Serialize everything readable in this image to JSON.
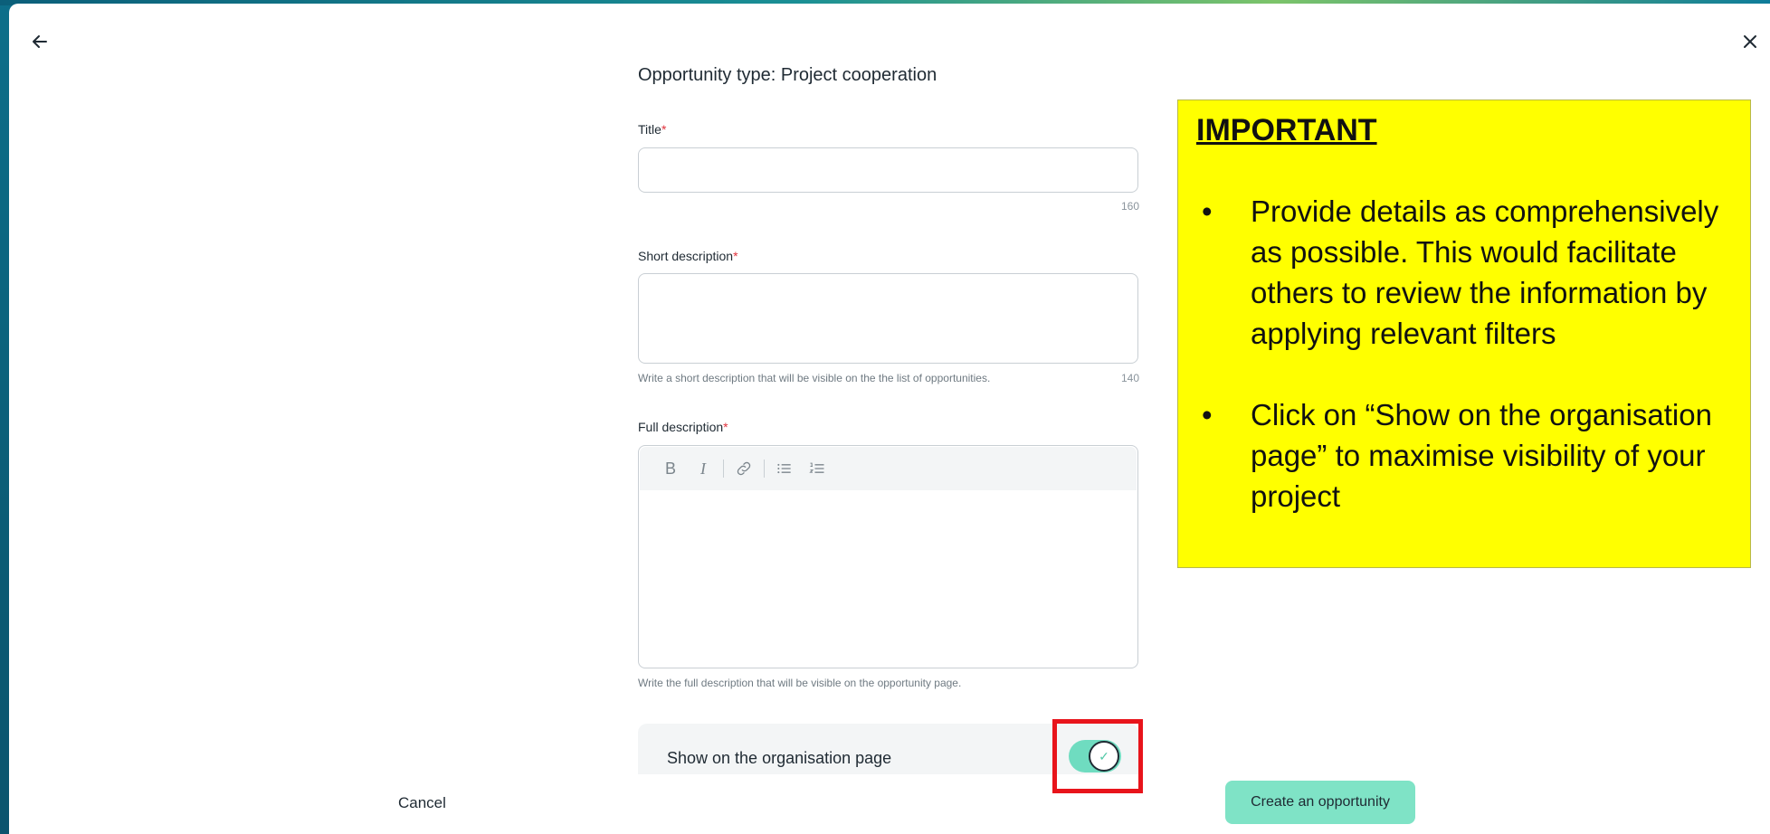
{
  "form": {
    "heading": "Opportunity type: Project cooperation",
    "title_field": {
      "label": "Title",
      "required_mark": "*",
      "value": "",
      "counter": "160"
    },
    "short_description": {
      "label": "Short description",
      "required_mark": "*",
      "value": "",
      "hint": "Write a short description that will be visible on the the list of opportunities.",
      "counter": "140"
    },
    "full_description": {
      "label": "Full description",
      "required_mark": "*",
      "value": "",
      "hint": "Write the full description that will be visible on the opportunity page.",
      "toolbar": {
        "bold": "B",
        "italic": "I",
        "link_icon": "link-icon",
        "bullet_list_icon": "bullet-list-icon",
        "numbered_list_icon": "numbered-list-icon"
      }
    },
    "show_on_org_page": {
      "label": "Show on the organisation page",
      "enabled": true
    }
  },
  "footer": {
    "cancel_label": "Cancel",
    "create_label": "Create an opportunity"
  },
  "callout": {
    "title": "IMPORTANT",
    "bullets": [
      "Provide details as comprehensively as possible. This would facilitate others to review the information by applying relevant filters",
      "Click on “Show on the organisation page” to maximise visibility of your project"
    ],
    "bullet_glyph": "•"
  },
  "colors": {
    "accent": "#7fe3c6",
    "toggle_on": "#6fdcc0",
    "required": "#e0323c",
    "callout_bg": "#ffff00",
    "highlight": "#e8141b"
  }
}
